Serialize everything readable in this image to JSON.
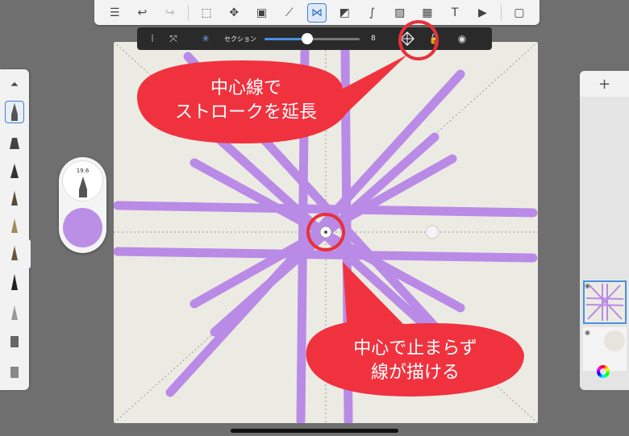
{
  "subtoolbar": {
    "section_label": "セクション",
    "section_value": "8",
    "slider_fraction": 0.45
  },
  "brush": {
    "size": "19.6",
    "color": "#bb8ee6"
  },
  "layers": {
    "add_label": "+"
  },
  "annotations": {
    "top_line1": "中心線で",
    "top_line2": "ストロークを延長",
    "bottom_line1": "中心で止まらず",
    "bottom_line2": "線が描ける"
  },
  "colors": {
    "callout_fill": "#f0323f",
    "stroke": "#b98be6",
    "canvas": "#ecebe3"
  }
}
